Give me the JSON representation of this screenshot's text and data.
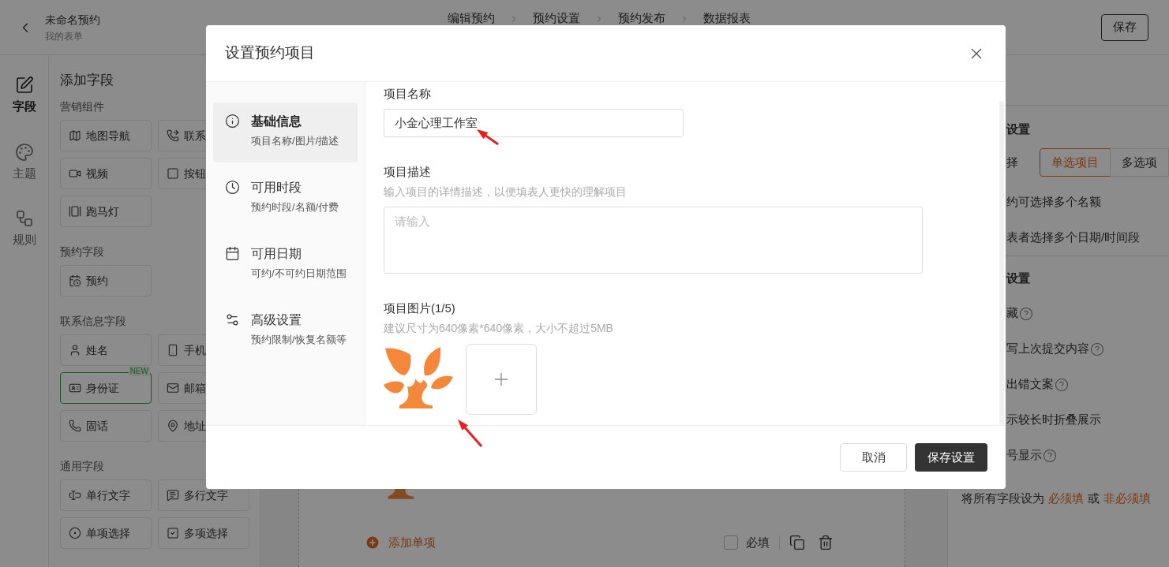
{
  "header": {
    "title": "未命名预约",
    "subtitle": "我的表单",
    "steps": [
      "编辑预约",
      "预约设置",
      "预约发布",
      "数据报表"
    ],
    "save_button": "保存"
  },
  "rail": [
    {
      "label": "字段",
      "selected": true,
      "kind": "edit"
    },
    {
      "label": "主题",
      "selected": false,
      "kind": "palette"
    },
    {
      "label": "规则",
      "selected": false,
      "kind": "rules"
    }
  ],
  "field_panel": {
    "title": "添加字段",
    "groups": [
      {
        "title": "营销组件",
        "items": [
          {
            "label": "地图导航",
            "kind": "map"
          },
          {
            "label": "联系",
            "kind": "phone-call"
          },
          {
            "label": "视频",
            "kind": "video"
          },
          {
            "label": "按钮",
            "kind": "button"
          },
          {
            "label": "跑马灯",
            "kind": "marquee"
          }
        ]
      },
      {
        "title": "预约字段",
        "items": [
          {
            "label": "预约",
            "kind": "calendar"
          }
        ]
      },
      {
        "title": "联系信息字段",
        "items": [
          {
            "label": "姓名",
            "kind": "user"
          },
          {
            "label": "手机",
            "kind": "mobile"
          },
          {
            "label": "身份证",
            "kind": "id-card",
            "badge": "NEW"
          },
          {
            "label": "邮箱",
            "kind": "mail"
          },
          {
            "label": "固话",
            "kind": "phone"
          },
          {
            "label": "地址",
            "kind": "location"
          }
        ]
      },
      {
        "title": "通用字段",
        "items": [
          {
            "label": "单行文字",
            "kind": "text"
          },
          {
            "label": "多行文字",
            "kind": "textarea"
          },
          {
            "label": "单项选择",
            "kind": "radio"
          },
          {
            "label": "多项选择",
            "kind": "checkbox"
          }
        ]
      }
    ]
  },
  "canvas": {
    "add_item": "添加单项",
    "required": {
      "label": "必填",
      "checked": false
    }
  },
  "settings_panel": {
    "sections": [
      {
        "title": "设置",
        "rows": [
          {
            "kind": "segmented",
            "label": "择",
            "options": [
              {
                "label": "单选项目",
                "selected": true
              },
              {
                "label": "多选项",
                "selected": false
              }
            ]
          },
          {
            "kind": "text",
            "label": "约可选择多个名额",
            "help": false
          },
          {
            "kind": "text",
            "label": "表者选择多个日期/时间段",
            "help": false
          }
        ]
      },
      {
        "title": "设置",
        "rows": [
          {
            "kind": "text",
            "label": "藏",
            "help": true
          },
          {
            "kind": "text",
            "label": "写上次提交内容",
            "help": true
          },
          {
            "kind": "text",
            "label": "出错文案",
            "help": true
          },
          {
            "kind": "text",
            "label": "示较长时折叠展示",
            "help": false
          },
          {
            "kind": "text",
            "label": "号显示",
            "help": true
          }
        ]
      }
    ],
    "bulk": {
      "prefix": "将所有字段设为",
      "links": [
        "必须填",
        "非必须填"
      ],
      "joiner": "或"
    }
  },
  "modal": {
    "title": "设置预约项目",
    "nav": [
      {
        "title": "基础信息",
        "subtitle": "项目名称/图片/描述",
        "selected": true,
        "kind": "info"
      },
      {
        "title": "可用时段",
        "subtitle": "预约时段/名额/付费",
        "selected": false,
        "kind": "clock"
      },
      {
        "title": "可用日期",
        "subtitle": "可约/不可约日期范围",
        "selected": false,
        "kind": "calendar"
      },
      {
        "title": "高级设置",
        "subtitle": "预约限制/恢复名额等",
        "selected": false,
        "kind": "settings"
      }
    ],
    "fields": [
      {
        "kind": "input",
        "label": "项目名称",
        "value": "小金心理工作室"
      },
      {
        "kind": "textarea",
        "label": "项目描述",
        "hint": "输入项目的详情描述，以便填表人更快的理解项目",
        "placeholder": "请输入"
      },
      {
        "kind": "images",
        "label": "项目图片(1/5)",
        "hint": "建议尺寸为640像素*640像素，大小不超过5MB",
        "images": [
          {
            "kind": "logo"
          }
        ]
      }
    ],
    "buttons": [
      {
        "label": "取消",
        "kind": "secondary"
      },
      {
        "label": "保存设置",
        "kind": "primary"
      }
    ]
  }
}
